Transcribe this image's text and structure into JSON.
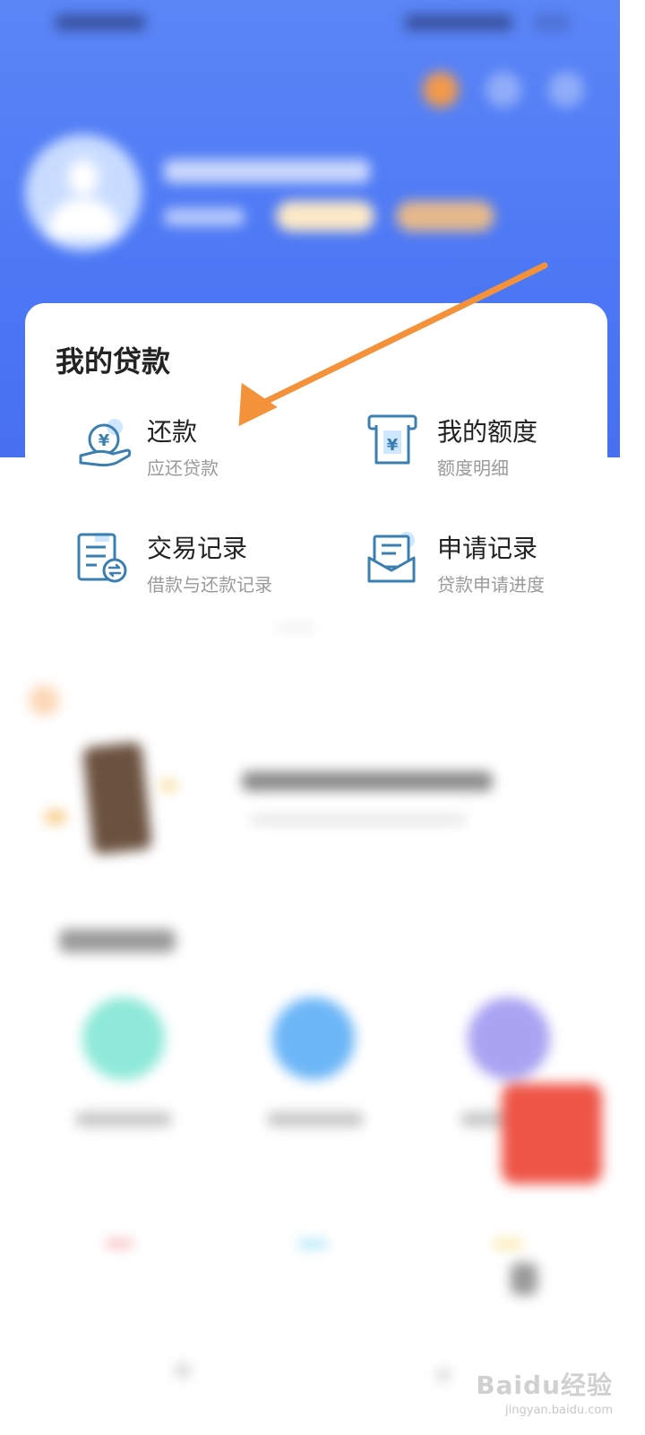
{
  "loan_section": {
    "title": "我的贷款",
    "items": [
      {
        "title": "还款",
        "subtitle": "应还贷款",
        "icon": "repay-yuan-icon"
      },
      {
        "title": "我的额度",
        "subtitle": "额度明细",
        "icon": "quota-yuan-icon"
      },
      {
        "title": "交易记录",
        "subtitle": "借款与还款记录",
        "icon": "transaction-record-icon"
      },
      {
        "title": "申请记录",
        "subtitle": "贷款申请进度",
        "icon": "application-envelope-icon"
      }
    ]
  },
  "annotation": {
    "color": "#f3923a",
    "points_to": "还款"
  },
  "colors": {
    "header_blue": "#5b86f6",
    "icon_blue": "#3b7fb0",
    "icon_light": "#cfe6ff",
    "title_text": "#222222",
    "subtitle_text": "#9a9a9a"
  },
  "watermark": {
    "brand": "Baidu经验",
    "url": "jingyan.baidu.com"
  }
}
